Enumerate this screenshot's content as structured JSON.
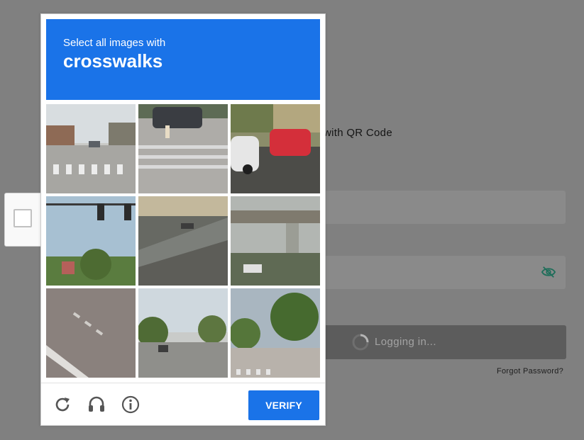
{
  "login": {
    "qr_text": "with QR Code",
    "login_button": "Logging in...",
    "forgot_password": "Forgot Password?"
  },
  "captcha": {
    "prompt_line1": "Select all images with",
    "prompt_object": "crosswalks",
    "tiles": [
      {
        "label": "street-crosswalk"
      },
      {
        "label": "crosswalk-pedestrian"
      },
      {
        "label": "parked-cars"
      },
      {
        "label": "traffic-lights"
      },
      {
        "label": "highway"
      },
      {
        "label": "overpass"
      },
      {
        "label": "crosswalk-closeup"
      },
      {
        "label": "road-trees"
      },
      {
        "label": "intersection"
      }
    ],
    "verify_label": "VERIFY",
    "footer_icons": [
      "reload-icon",
      "audio-icon",
      "info-icon"
    ]
  },
  "colors": {
    "accent": "#1a73e8",
    "overlay": "#808080"
  }
}
